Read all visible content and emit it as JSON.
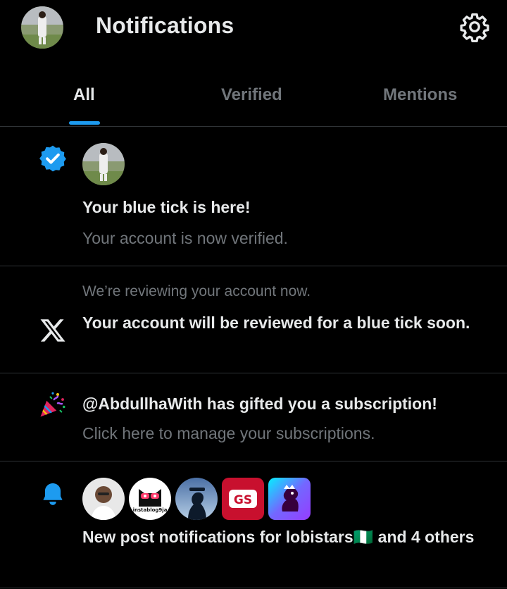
{
  "header": {
    "title": "Notifications",
    "avatar_icon": "profile-avatar",
    "settings_icon": "gear-icon"
  },
  "tabs": [
    {
      "label": "All",
      "active": true
    },
    {
      "label": "Verified",
      "active": false
    },
    {
      "label": "Mentions",
      "active": false
    }
  ],
  "notifications": [
    {
      "icon": "verified-badge-icon",
      "title": "Your blue tick is here!",
      "subtitle": "Your account is now verified."
    },
    {
      "icon": "x-logo-icon",
      "pre_text": "We’re reviewing your account now.",
      "title": "Your account will be reviewed for a blue tick soon."
    },
    {
      "icon": "party-popper-icon",
      "title": "@AbdullhaWith has gifted you a subscription!",
      "subtitle": "Click here to manage your subscriptions."
    },
    {
      "icon": "bell-icon",
      "avatar_badge_text": "instablog9ja",
      "title": "New post notifications for lobistars🇳🇬 and 4 others"
    }
  ],
  "colors": {
    "background": "#000000",
    "accent": "#1d9bf0",
    "text_primary": "#e7e9ea",
    "text_secondary": "#71767b",
    "divider": "#2f3336"
  }
}
